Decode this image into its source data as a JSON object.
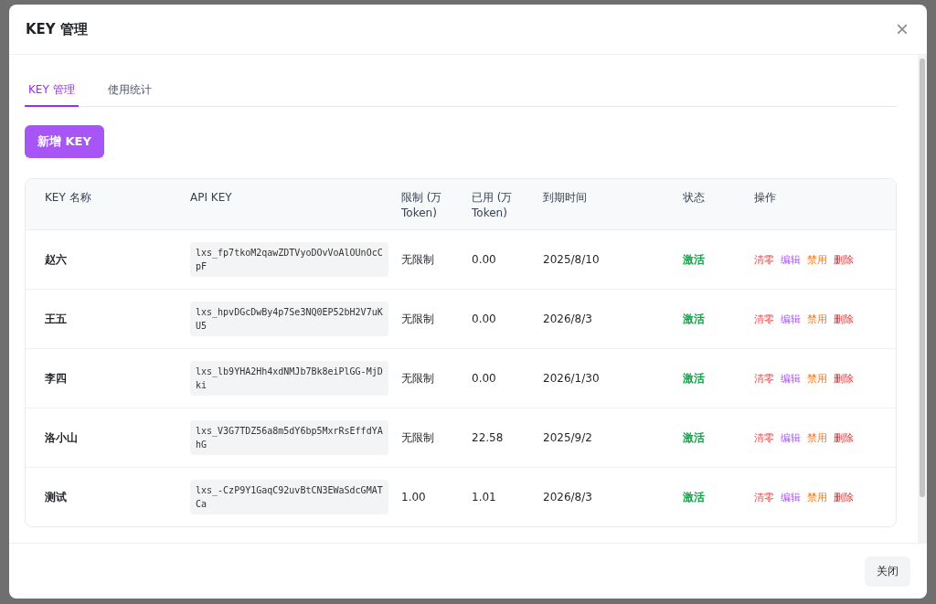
{
  "dialog": {
    "title": "KEY 管理",
    "close_icon": "×"
  },
  "tabs": [
    {
      "label": "KEY 管理",
      "selected": true
    },
    {
      "label": "使用统计",
      "selected": false
    }
  ],
  "add_button": "新增 KEY",
  "table": {
    "columns": [
      "KEY 名称",
      "API KEY",
      "限制 (万 Token)",
      "已用 (万 Token)",
      "到期时间",
      "状态",
      "操作"
    ],
    "rows": [
      {
        "name": "赵六",
        "api_key": "lxs_fp7tkoM2qawZDTVyoDOvVoAlOUnOcCpF",
        "limit": "无限制",
        "used": "0.00",
        "expiry": "2025/8/10",
        "status": {
          "label": "激活",
          "kind": "active"
        },
        "actions": [
          {
            "label": "清零",
            "kind": "reset"
          },
          {
            "label": "编辑",
            "kind": "edit"
          },
          {
            "label": "禁用",
            "kind": "disable"
          },
          {
            "label": "删除",
            "kind": "delete"
          }
        ]
      },
      {
        "name": "王五",
        "api_key": "lxs_hpvDGcDwBy4p7Se3NQ0EP52bH2V7uKU5",
        "limit": "无限制",
        "used": "0.00",
        "expiry": "2026/8/3",
        "status": {
          "label": "激活",
          "kind": "active"
        },
        "actions": [
          {
            "label": "清零",
            "kind": "reset"
          },
          {
            "label": "编辑",
            "kind": "edit"
          },
          {
            "label": "禁用",
            "kind": "disable"
          },
          {
            "label": "删除",
            "kind": "delete"
          }
        ]
      },
      {
        "name": "李四",
        "api_key": "lxs_lb9YHA2Hh4xdNMJb7Bk8eiPlGG-MjDki",
        "limit": "无限制",
        "used": "0.00",
        "expiry": "2026/1/30",
        "status": {
          "label": "激活",
          "kind": "active"
        },
        "actions": [
          {
            "label": "清零",
            "kind": "reset"
          },
          {
            "label": "编辑",
            "kind": "edit"
          },
          {
            "label": "禁用",
            "kind": "disable"
          },
          {
            "label": "删除",
            "kind": "delete"
          }
        ]
      },
      {
        "name": "洛小山",
        "api_key": "lxs_V3G7TDZ56a8m5dY6bp5MxrRsEffdYAhG",
        "limit": "无限制",
        "used": "22.58",
        "expiry": "2025/9/2",
        "status": {
          "label": "激活",
          "kind": "active"
        },
        "actions": [
          {
            "label": "清零",
            "kind": "reset"
          },
          {
            "label": "编辑",
            "kind": "edit"
          },
          {
            "label": "禁用",
            "kind": "disable"
          },
          {
            "label": "删除",
            "kind": "delete"
          }
        ]
      },
      {
        "name": "测试",
        "api_key": "lxs_-CzP9Y1GaqC92uvBtCN3EWaSdcGMATCa",
        "limit": "1.00",
        "used": "1.01",
        "expiry": "2026/8/3",
        "status": {
          "label": "激活",
          "kind": "active"
        },
        "actions": [
          {
            "label": "清零",
            "kind": "reset"
          },
          {
            "label": "编辑",
            "kind": "edit"
          },
          {
            "label": "禁用",
            "kind": "disable"
          },
          {
            "label": "删除",
            "kind": "delete"
          }
        ]
      }
    ]
  },
  "footer_button": "关闭"
}
